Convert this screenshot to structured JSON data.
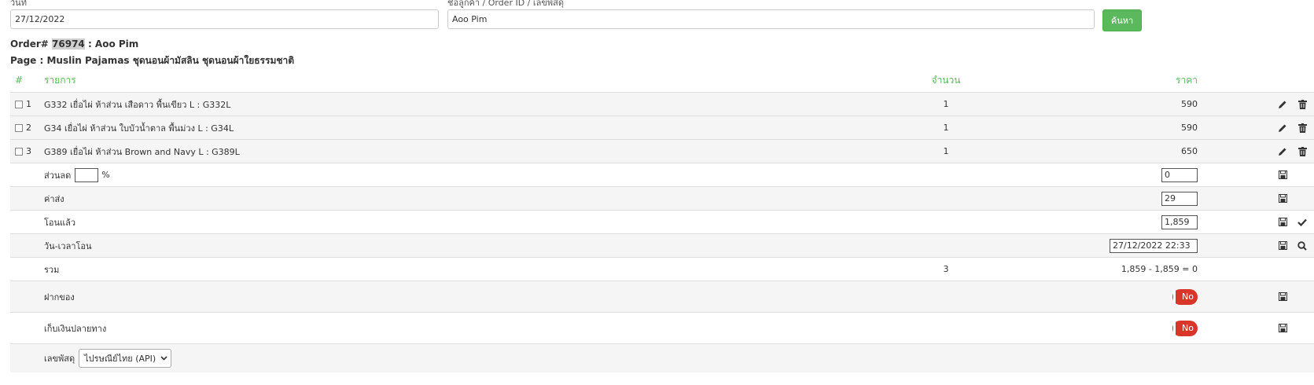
{
  "search": {
    "date_label": "วันที่",
    "customer_label": "ชื่อลูกค้า / Order ID / เลขพัสดุ",
    "date_value": "27/12/2022",
    "customer_value": "Aoo Pim",
    "button_label": "ค้นหา"
  },
  "order": {
    "prefix": "Order#",
    "id": "76974",
    "sep": " : ",
    "customer": "Aoo Pim",
    "page_prefix": "Page : ",
    "page_name": "Muslin Pajamas ชุดนอนผ้ามัสลิน ชุดนอนผ้าใยธรรมชาติ"
  },
  "table": {
    "headers": {
      "num": "#",
      "item": "รายการ",
      "qty": "จำนวน",
      "price": "ราคา"
    },
    "items": [
      {
        "num": "1",
        "name": "G332 เยื่อไผ่ ห้าส่วน เสือดาว พื้นเขียว L : G332L",
        "qty": "1",
        "price": "590"
      },
      {
        "num": "2",
        "name": "G34 เยื่อไผ่ ห้าส่วน ใบบัวน้ำตาล พื้นม่วง L : G34L",
        "qty": "1",
        "price": "590"
      },
      {
        "num": "3",
        "name": "G389 เยื่อไผ่ ห้าส่วน Brown and Navy L : G389L",
        "qty": "1",
        "price": "650"
      }
    ],
    "discount": {
      "label": "ส่วนลด",
      "unit": "%",
      "value": "0"
    },
    "shipping": {
      "label": "ค่าส่ง",
      "value": "29"
    },
    "paid": {
      "label": "โอนแล้ว",
      "value": "1,859"
    },
    "paid_datetime": {
      "label": "วัน-เวลาโอน",
      "value": "27/12/2022 22:33"
    },
    "total": {
      "label": "รวม",
      "qty": "3",
      "summary": "1,859 - 1,859 = 0"
    },
    "deposit": {
      "label": "ฝากของ",
      "toggle": "No"
    },
    "cod": {
      "label": "เก็บเงินปลายทาง",
      "toggle": "No"
    },
    "tracking": {
      "label": "เลขพัสดุ",
      "carrier": "ไปรษณีย์ไทย (API)"
    }
  },
  "colors": {
    "accent": "#5cb85c",
    "toggle_off": "#d9362a",
    "row_shade": "#f5f5f5"
  },
  "icons": [
    "pencil-icon",
    "trash-icon",
    "save-icon",
    "check-icon",
    "search-icon",
    "chevron-down-icon"
  ]
}
